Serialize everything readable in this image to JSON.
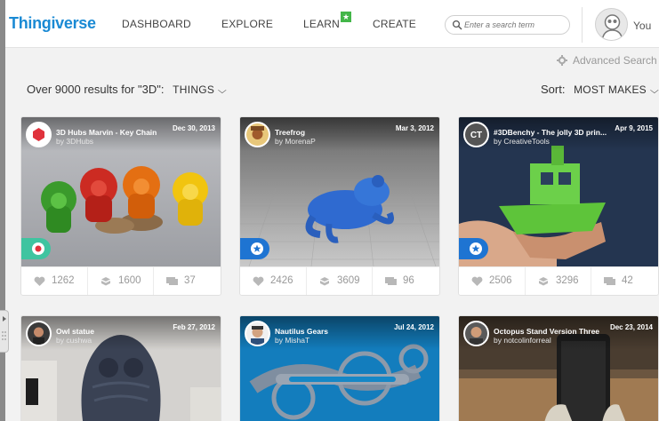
{
  "header": {
    "logo": "Thingiverse",
    "nav": [
      "DASHBOARD",
      "EXPLORE",
      "LEARN",
      "CREATE"
    ],
    "learn_badge": "★",
    "search_placeholder": "Enter a search term",
    "user_label": "You"
  },
  "toolbar": {
    "advanced_search": "Advanced Search",
    "results_text": "Over 9000 results for \"3D\":",
    "results_filter": "THINGS",
    "sort_label": "Sort:",
    "sort_value": "MOST MAKES"
  },
  "cards": [
    {
      "title": "3D Hubs Marvin - Key Chain",
      "author": "by 3DHubs",
      "date": "Dec 30, 2013",
      "likes": "1262",
      "collects": "1600",
      "comments": "37",
      "badge": "featured"
    },
    {
      "title": "Treefrog",
      "author": "by MorenaP",
      "date": "Mar 3, 2012",
      "likes": "2426",
      "collects": "3609",
      "comments": "96",
      "badge": "staff-pick"
    },
    {
      "title": "#3DBenchy - The jolly 3D prin...",
      "author": "by CreativeTools",
      "date": "Apr 9, 2015",
      "likes": "2506",
      "collects": "3296",
      "comments": "42",
      "badge": "staff-pick"
    },
    {
      "title": "Owl statue",
      "author": "by cushwa",
      "date": "Feb 27, 2012"
    },
    {
      "title": "Nautilus Gears",
      "author": "by MishaT",
      "date": "Jul 24, 2012"
    },
    {
      "title": "Octopus Stand Version Three",
      "author": "by notcolinforreal",
      "date": "Dec 23, 2014"
    }
  ],
  "colors": {
    "brand": "#1a8ad4",
    "featured_badge": "#3fc4a0",
    "staff_pick_badge": "#1e74d2"
  }
}
